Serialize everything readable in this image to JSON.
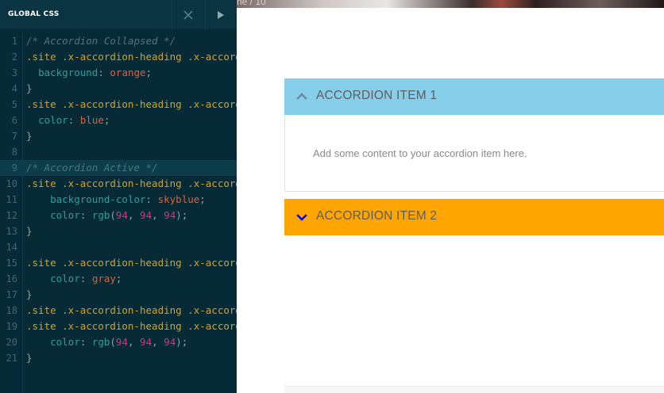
{
  "editor": {
    "title": "GLOBAL CSS",
    "close_icon": "close-icon",
    "run_icon": "play-icon",
    "lines": [
      {
        "n": "1",
        "tokens": [
          {
            "t": "comment",
            "v": "/* Accordion Collapsed */"
          }
        ]
      },
      {
        "n": "2",
        "tokens": [
          {
            "t": "sel",
            "v": ".site .x-accordion-heading .x-accordion-toggle.collapsed"
          },
          {
            "t": "brace",
            "v": " {"
          }
        ]
      },
      {
        "n": "3",
        "tokens": [
          {
            "t": "plain",
            "v": "  "
          },
          {
            "t": "prop",
            "v": "background"
          },
          {
            "t": "punct",
            "v": ": "
          },
          {
            "t": "val",
            "v": "orange"
          },
          {
            "t": "punct",
            "v": ";"
          }
        ]
      },
      {
        "n": "4",
        "tokens": [
          {
            "t": "brace",
            "v": "}"
          }
        ]
      },
      {
        "n": "5",
        "tokens": [
          {
            "t": "sel",
            "v": ".site .x-accordion-heading .x-accordion-toggle.collapsed:before"
          },
          {
            "t": "brace",
            "v": " {"
          }
        ]
      },
      {
        "n": "6",
        "tokens": [
          {
            "t": "plain",
            "v": "  "
          },
          {
            "t": "prop",
            "v": "color"
          },
          {
            "t": "punct",
            "v": ": "
          },
          {
            "t": "val",
            "v": "blue"
          },
          {
            "t": "punct",
            "v": ";"
          }
        ]
      },
      {
        "n": "7",
        "tokens": [
          {
            "t": "brace",
            "v": "}"
          }
        ]
      },
      {
        "n": "8",
        "tokens": []
      },
      {
        "n": "9",
        "tokens": [
          {
            "t": "comment",
            "v": "/* Accordion Active */"
          }
        ],
        "active": true
      },
      {
        "n": "10",
        "tokens": [
          {
            "t": "sel",
            "v": ".site .x-accordion-heading .x-accordion-toggle"
          },
          {
            "t": "brace",
            "v": " {"
          }
        ]
      },
      {
        "n": "11",
        "tokens": [
          {
            "t": "plain",
            "v": "    "
          },
          {
            "t": "prop",
            "v": "background-color"
          },
          {
            "t": "punct",
            "v": ": "
          },
          {
            "t": "val",
            "v": "skyblue"
          },
          {
            "t": "punct",
            "v": ";"
          }
        ]
      },
      {
        "n": "12",
        "tokens": [
          {
            "t": "plain",
            "v": "    "
          },
          {
            "t": "prop",
            "v": "color"
          },
          {
            "t": "punct",
            "v": ": "
          },
          {
            "t": "prop",
            "v": "rgb"
          },
          {
            "t": "punct",
            "v": "("
          },
          {
            "t": "num",
            "v": "94"
          },
          {
            "t": "punct",
            "v": ", "
          },
          {
            "t": "num",
            "v": "94"
          },
          {
            "t": "punct",
            "v": ", "
          },
          {
            "t": "num",
            "v": "94"
          },
          {
            "t": "punct",
            "v": ");"
          }
        ]
      },
      {
        "n": "13",
        "tokens": [
          {
            "t": "brace",
            "v": "}"
          }
        ]
      },
      {
        "n": "14",
        "tokens": []
      },
      {
        "n": "15",
        "tokens": [
          {
            "t": "sel",
            "v": ".site .x-accordion-heading .x-accordion-toggle:before"
          },
          {
            "t": "brace",
            "v": " {"
          }
        ]
      },
      {
        "n": "16",
        "tokens": [
          {
            "t": "plain",
            "v": "    "
          },
          {
            "t": "prop",
            "v": "color"
          },
          {
            "t": "punct",
            "v": ": "
          },
          {
            "t": "val",
            "v": "gray"
          },
          {
            "t": "punct",
            "v": ";"
          }
        ]
      },
      {
        "n": "17",
        "tokens": [
          {
            "t": "brace",
            "v": "}"
          }
        ]
      },
      {
        "n": "18",
        "tokens": [
          {
            "t": "sel",
            "v": ".site .x-accordion-heading .x-accordion-toggle:hover"
          },
          {
            "t": "punct",
            "v": ","
          }
        ]
      },
      {
        "n": "19",
        "tokens": [
          {
            "t": "sel",
            "v": ".site .x-accordion-heading .x-accordion-toggle:focus"
          },
          {
            "t": "brace",
            "v": " {"
          }
        ]
      },
      {
        "n": "20",
        "tokens": [
          {
            "t": "plain",
            "v": "    "
          },
          {
            "t": "prop",
            "v": "color"
          },
          {
            "t": "punct",
            "v": ": "
          },
          {
            "t": "prop",
            "v": "rgb"
          },
          {
            "t": "punct",
            "v": "("
          },
          {
            "t": "num",
            "v": "94"
          },
          {
            "t": "punct",
            "v": ", "
          },
          {
            "t": "num",
            "v": "94"
          },
          {
            "t": "punct",
            "v": ", "
          },
          {
            "t": "num",
            "v": "94"
          },
          {
            "t": "punct",
            "v": ");"
          }
        ]
      },
      {
        "n": "21",
        "tokens": [
          {
            "t": "brace",
            "v": "}"
          }
        ]
      }
    ]
  },
  "preview": {
    "top_image_caption": "ne / 10",
    "accordion": [
      {
        "label": "ACCORDION ITEM 1",
        "state": "expanded",
        "icon": "chevron-up-icon",
        "icon_color": "#6b8c98",
        "body": "Add some content to your accordion item here.",
        "color": "#87ceeb"
      },
      {
        "label": "ACCORDION ITEM 2",
        "state": "collapsed",
        "icon": "chevron-down-icon",
        "icon_color": "#0000ff",
        "color": "#ffa500"
      }
    ]
  }
}
